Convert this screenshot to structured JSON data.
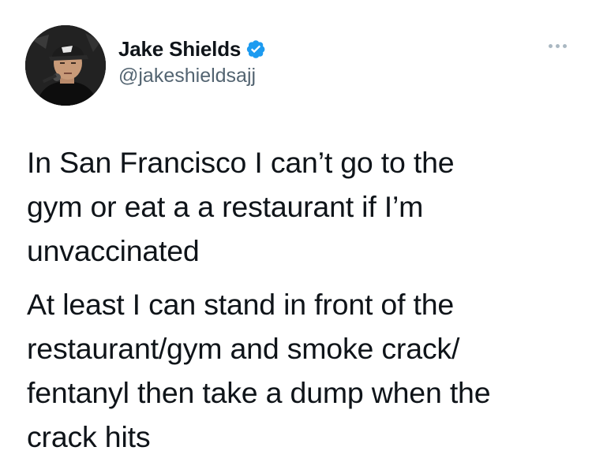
{
  "tweet": {
    "author": {
      "display_name": "Jake Shields",
      "handle": "@jakeshieldsajj",
      "verified": true,
      "avatar_icon": "profile-photo"
    },
    "more_icon": "ellipsis-icon",
    "paragraphs": [
      "In San Francisco I can’t go to the gym or eat a a restaurant if I’m unvaccinated",
      "At least I can stand in front of the restaurant/gym and smoke crack/ fentanyl then take a dump when the crack hits"
    ],
    "lines": [
      [
        "In San Francisco I can’t go to the",
        "gym or eat a a restaurant if I’m",
        "unvaccinated"
      ],
      [
        "At least I can stand in front of the",
        "restaurant/gym and smoke crack/",
        "fentanyl then take a dump when the",
        "crack hits"
      ]
    ],
    "colors": {
      "verified_badge": "#1d9bf0",
      "handle": "#536471",
      "text": "#0f1419",
      "more_dots": "#aab8c2"
    }
  }
}
